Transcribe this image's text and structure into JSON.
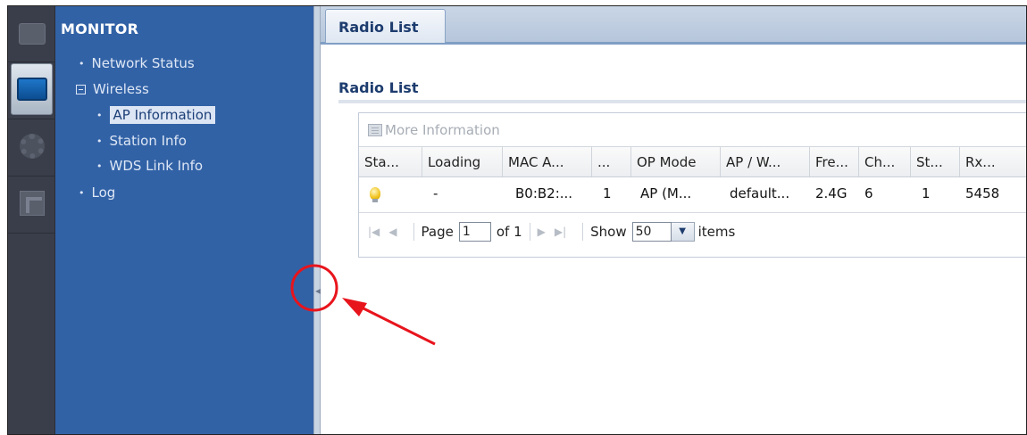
{
  "sidebar": {
    "title": "MONITOR",
    "items": [
      {
        "label": "Network Status"
      },
      {
        "label": "Wireless"
      },
      {
        "label": "AP Information"
      },
      {
        "label": "Station Info"
      },
      {
        "label": "WDS Link Info"
      },
      {
        "label": "Log"
      }
    ],
    "selected": "AP Information"
  },
  "tab": {
    "label": "Radio List"
  },
  "section": {
    "title": "Radio List"
  },
  "toolbar": {
    "more_info_label": "More Information"
  },
  "table": {
    "columns": [
      "Sta...",
      "Loading",
      "MAC A...",
      "...",
      "OP Mode",
      "AP / W...",
      "Fre...",
      "Ch...",
      "St...",
      "Rx..."
    ],
    "rows": [
      [
        "",
        "-",
        "B0:B2:...",
        "1",
        "AP (M...",
        "default...",
        "2.4G",
        "6",
        "1",
        "5458"
      ]
    ]
  },
  "pager": {
    "page_label": "Page",
    "page_value": "1",
    "of_label": "of 1",
    "show_label": "Show",
    "show_value": "50",
    "items_label": "items"
  },
  "colors": {
    "nav_bg": "#3262a6",
    "annotation": "#e8141c"
  }
}
